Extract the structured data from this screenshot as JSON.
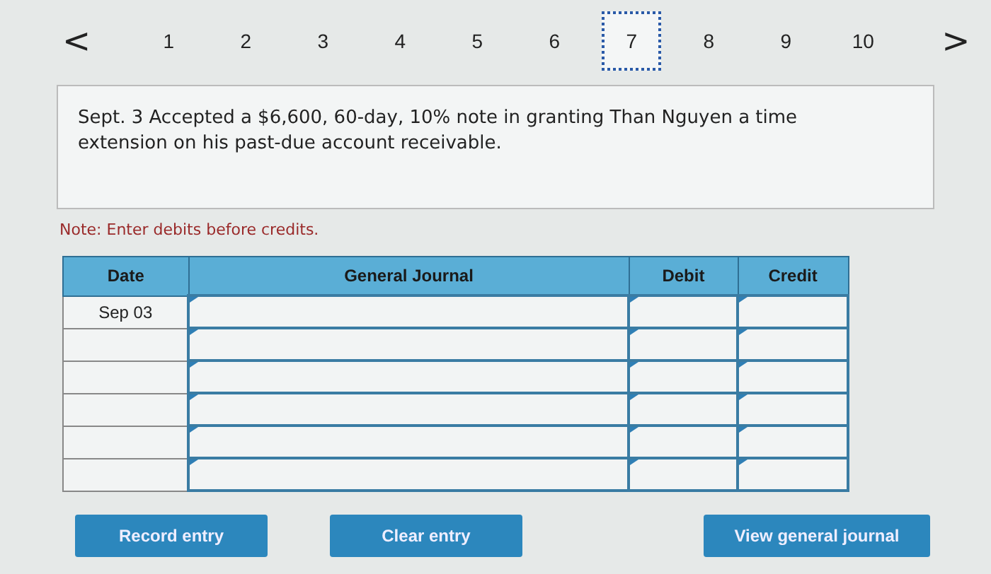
{
  "pagination": {
    "previous": "<",
    "next": ">",
    "pages": [
      {
        "label": "1",
        "selected": false
      },
      {
        "label": "2",
        "selected": false
      },
      {
        "label": "3",
        "selected": false
      },
      {
        "label": "4",
        "selected": false
      },
      {
        "label": "5",
        "selected": false
      },
      {
        "label": "6",
        "selected": false
      },
      {
        "label": "7",
        "selected": true
      },
      {
        "label": "8",
        "selected": false
      },
      {
        "label": "9",
        "selected": false
      },
      {
        "label": "10",
        "selected": false
      }
    ]
  },
  "question": "Sept. 3 Accepted a $6,600, 60-day, 10% note in granting Than Nguyen a time extension on his past-due account receivable.",
  "note": "Note: Enter debits before credits.",
  "journal": {
    "columns": [
      "Date",
      "General Journal",
      "Debit",
      "Credit"
    ],
    "rows": [
      {
        "kind": "dated",
        "date": "Sep 03"
      },
      {
        "kind": "blank"
      },
      {
        "kind": "blank"
      },
      {
        "kind": "blank"
      },
      {
        "kind": "blank"
      },
      {
        "kind": "blank"
      }
    ]
  },
  "buttons": [
    "Record entry",
    "Clear entry",
    "View general journal"
  ]
}
